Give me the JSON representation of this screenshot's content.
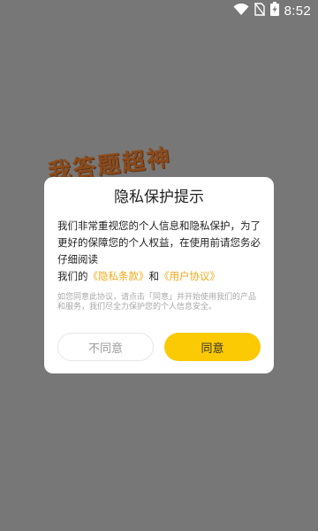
{
  "status_bar": {
    "time": "8:52",
    "icons": [
      "wifi-icon",
      "sim-off-icon",
      "battery-charging-icon"
    ]
  },
  "background": {
    "title": "我答题超神"
  },
  "dialog": {
    "title": "隐私保护提示",
    "body_line1": "我们非常重视您的个人信息和隐私保护，为了更好的保障您的个人权益，在使用前请您务必仔细阅读",
    "body_prefix": "我们的",
    "privacy_link": "《隐私条款》",
    "conjunction": "和",
    "terms_link": "《用户协议》",
    "note": "如您同意此协议，请点击「同意」并开始使用我们的产品和服务，我们尽全力保护您的个人信息安全。",
    "decline_label": "不同意",
    "accept_label": "同意"
  },
  "colors": {
    "accent": "#fcc905",
    "link": "#f0a91c",
    "backdrop": "#777777"
  }
}
